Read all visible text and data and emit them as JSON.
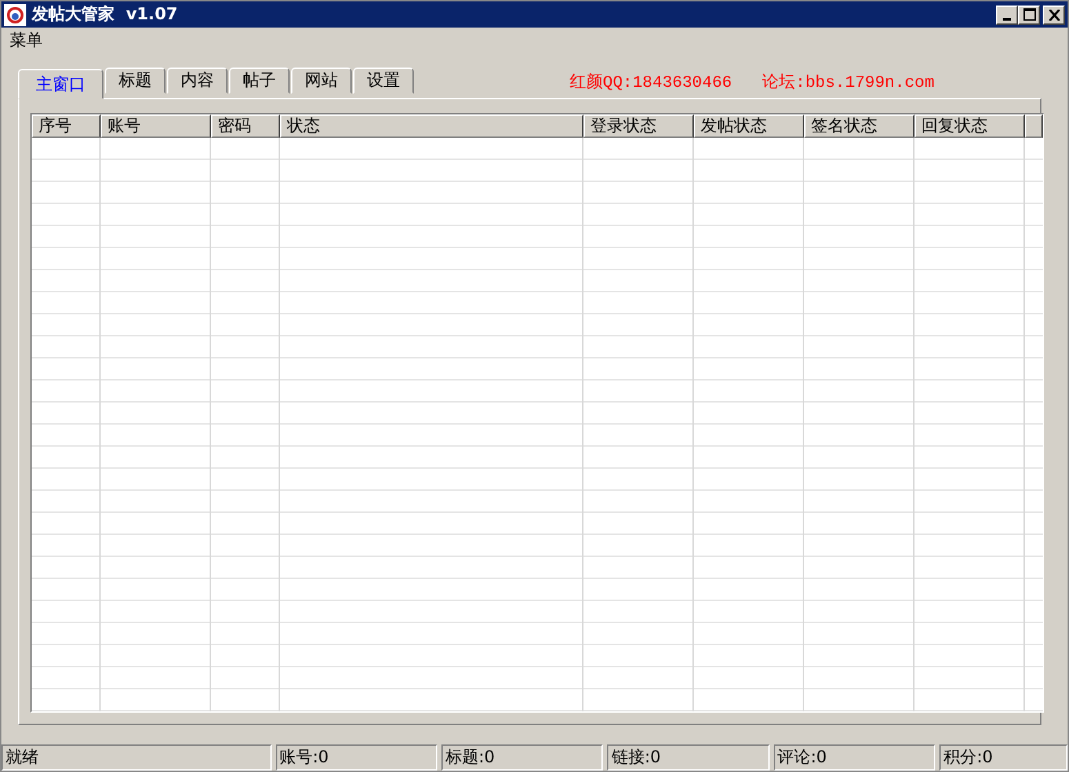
{
  "window": {
    "title": "发帖大管家  v1.07"
  },
  "menu": [
    "菜单"
  ],
  "tabs": [
    {
      "label": "主窗口",
      "selected": true
    },
    {
      "label": "标题",
      "selected": false
    },
    {
      "label": "内容",
      "selected": false
    },
    {
      "label": "帖子",
      "selected": false
    },
    {
      "label": "网站",
      "selected": false
    },
    {
      "label": "设置",
      "selected": false
    }
  ],
  "info": [
    "红颜QQ:1843630466",
    "论坛:bbs.1799n.com"
  ],
  "table": {
    "columns": [
      "序号",
      "账号",
      "密码",
      "状态",
      "登录状态",
      "发帖状态",
      "签名状态",
      "回复状态"
    ]
  },
  "status_bar": [
    "就绪",
    "账号:0",
    "标题:0",
    "链接:0",
    "评论:0",
    "积分:0"
  ]
}
